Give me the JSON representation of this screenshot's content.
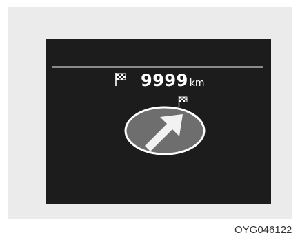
{
  "display": {
    "distance_value": "9999",
    "distance_unit": "km",
    "destination_icon": "checkered-flag-icon",
    "direction_icon": "arrow-up-right-icon"
  },
  "caption": "OYG046122",
  "colors": {
    "background": "#ffffff",
    "panel": "#ebebeb",
    "screen": "#1c1c1c",
    "divider": "#8a8a8a",
    "text": "#ffffff",
    "direction_disc": "#6e6e6e",
    "arrow": "#f2f2f2"
  }
}
